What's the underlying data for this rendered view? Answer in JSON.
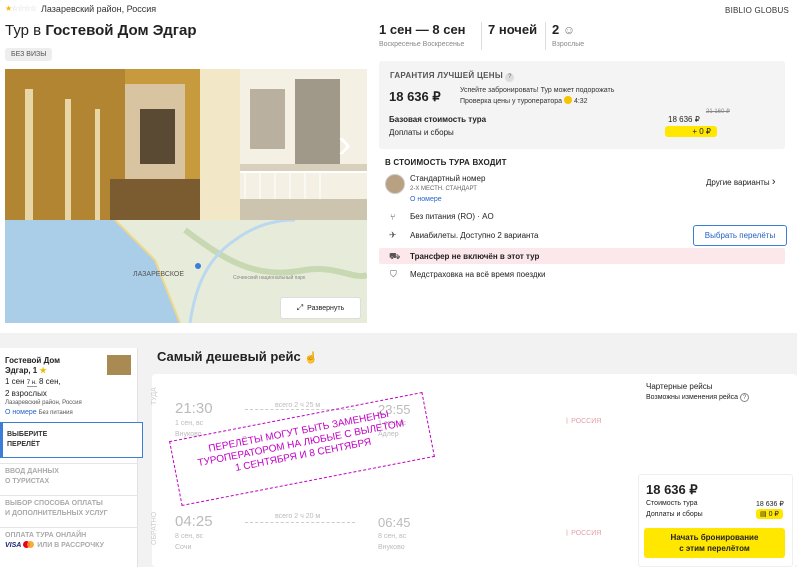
{
  "header": {
    "stars_filled": "★",
    "stars_empty": "☆☆☆☆",
    "location": "Лазаревский район, Россия",
    "operator": "BIBLIO GLOBUS",
    "title_prefix": "Тур в",
    "title_hotel": "Гостевой Дом Эдгар",
    "visa_badge": "БЕЗ ВИЗЫ"
  },
  "map": {
    "place_label": "ЛАЗАРЕВСКОЕ",
    "park_label": "Сочинский национальный парк",
    "expand_icon": "expand-arrows-icon",
    "expand_label": "Развернуть"
  },
  "trip": {
    "dates": "1 сен — 8 сен",
    "day_from": "Воскресенье",
    "day_to": "Воскресенье",
    "nights": "7 ночей",
    "adults_count": "2",
    "adults_label": "Взрослые",
    "person_icon": "person-icon"
  },
  "pricing": {
    "guarantee": "ГАРАНТИЯ ЛУЧШЕЙ ЦЕНЫ",
    "help_mark": "?",
    "main_price": "18 636 ₽",
    "promo_line1": "Успейте забронировать! Тур может подорожать",
    "promo_line2_prefix": "Проверка цены у туроператора",
    "promo_timer": "4:32",
    "base_label": "Базовая стоимость тура",
    "old_price": "21 160 ₽",
    "base_value": "18 636 ₽",
    "fees_label": "Доплаты и сборы",
    "fees_value": "+ 0 ₽"
  },
  "includes": {
    "title": "В СТОИМОСТЬ ТУРА ВХОДИТ",
    "room_name": "Стандартный номер",
    "room_type": "2-Х МЕСТН. СТАНДАРТ",
    "room_link": "О номере",
    "other_variants": "Другие варианты",
    "meal": "Без питания (RO) · AO",
    "flights": "Авиабилеты. Доступно 2 варианта",
    "flights_button": "Выбрать перелёты",
    "transfer": "Трансфер не включён в этот тур",
    "insurance": "Медстраховка на всё время поездки"
  },
  "sidebar": {
    "hotel_line1": "Гостевой Дом",
    "hotel_line2": "Эдгар, 1",
    "hotel_star": "★",
    "dates_from": "1 сен",
    "nights_badge": "7 н.",
    "dates_to": "8 сен,",
    "adults": "2 взрослых",
    "location": "Лазаревский район, Россия",
    "room_link": "О номере",
    "meal": "Без питания",
    "steps": [
      {
        "label1": "ВЫБЕРИТЕ",
        "label2": "ПЕРЕЛЁТ"
      },
      {
        "label1": "ВВОД ДАННЫХ",
        "label2": "О ТУРИСТАХ"
      },
      {
        "label1": "ВЫБОР СПОСОБА ОПЛАТЫ",
        "label2": "И ДОПОЛНИТЕЛЬНЫХ УСЛУГ"
      },
      {
        "label1": "ОПЛАТА ТУРА ОНЛАЙН",
        "label2": "ИЛИ В РАССРОЧКУ"
      }
    ],
    "visa_logo": "VISA"
  },
  "flights": {
    "section_title": "Самый дешевый рейс",
    "thumb_icon": "thumbs-up-icon",
    "out": {
      "side": "ТУДА",
      "dep_time": "21:30",
      "dep_date": "1 сен, вс",
      "dep_airport": "Внуково",
      "duration": "всего 2 ч 25 м",
      "arr_time": "23:55",
      "arr_date": "1 сен, вс",
      "arr_airport": "Адлер",
      "airline": "РОССИЯ"
    },
    "back": {
      "side": "ОБРАТНО",
      "dep_time": "04:25",
      "dep_date": "8 сен, вс",
      "dep_airport": "Сочи",
      "duration": "всего 2 ч 20 м",
      "arr_time": "06:45",
      "arr_date": "8 сен, вс",
      "arr_airport": "Внуково",
      "airline": "РОССИЯ"
    },
    "charter": "Чартерные рейсы",
    "changes": "Возможны изменения рейса",
    "stamp_line1": "ПЕРЕЛЁТЫ МОГУТ БЫТЬ ЗАМЕНЕНЫ",
    "stamp_line2": "ТУРОПЕРАТОРОМ НА ЛЮБЫЕ С ВЫЛЕТОМ",
    "stamp_line3": "1 СЕНТЯБРЯ И 8 СЕНТЯБРЯ"
  },
  "price_card": {
    "price": "18 636 ₽",
    "base_label": "Стоимость тура",
    "base_value": "18 636 ₽",
    "fees_label": "Доплаты и сборы",
    "fees_value": "0 ₽",
    "book_line1": "Начать бронирование",
    "book_line2": "с этим перелётом"
  }
}
